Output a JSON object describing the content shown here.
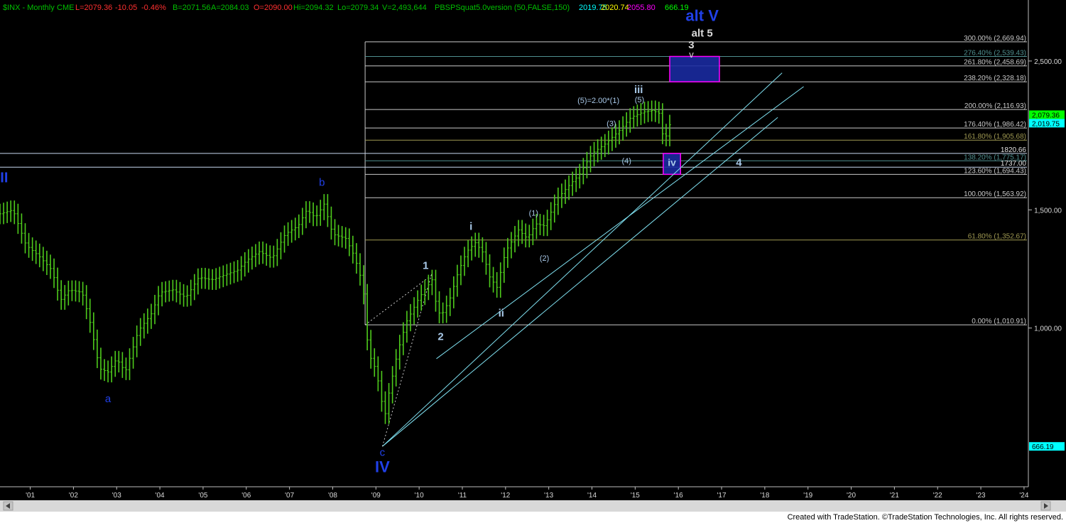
{
  "header": {
    "symbol": "$INX - Monthly",
    "exchange": "CME",
    "last": "L=2079.36",
    "change": "-10.05",
    "change_pct": "-0.46%",
    "bid": "B=2071.56",
    "ask": "A=2084.03",
    "open": "O=2090.00",
    "high": "Hi=2094.32",
    "low": "Lo=2079.34",
    "volume": "V=2,493,644",
    "study": "PBSPSquat5.0version (50,FALSE,150)",
    "study_values": [
      {
        "text": "2019.75",
        "color": "#00ffff"
      },
      {
        "text": "2020.74",
        "color": "#ffff00"
      },
      {
        "text": "2055.80",
        "color": "#ff00ff"
      },
      {
        "text": "666.19",
        "color": "#00ff00"
      }
    ]
  },
  "footer": {
    "credit": "Created with TradeStation. ©TradeStation Technologies, Inc. All rights reserved."
  },
  "chart_data": {
    "type": "line",
    "scale": "log",
    "ylim": [
      580,
      2950
    ],
    "xlim": [
      2000.3,
      2024.1
    ],
    "grid": false,
    "x_ticks": [
      "'01",
      "'02",
      "'03",
      "'04",
      "'05",
      "'06",
      "'07",
      "'08",
      "'09",
      "'10",
      "'11",
      "'12",
      "'13",
      "'14",
      "'15",
      "'16",
      "'17",
      "'18",
      "'19",
      "'20",
      "'21",
      "'22",
      "'23",
      "'24"
    ],
    "y_ticks": [
      {
        "value": 2500,
        "label": "2,500.00"
      },
      {
        "value": 1500,
        "label": "1,500.00"
      },
      {
        "value": 1000,
        "label": "1,000.00"
      }
    ],
    "price_tags": [
      {
        "value": 2079.36,
        "label": "2,079.36",
        "bg": "#00ff00"
      },
      {
        "value": 2019.75,
        "label": "2,019.75",
        "bg": "#00ffff"
      },
      {
        "value": 666.19,
        "label": "666.19",
        "bg": "#00ffff"
      }
    ],
    "series": [
      {
        "color": "#4ecb1c",
        "points": [
          [
            2000.3,
            1480
          ],
          [
            2000.6,
            1500
          ],
          [
            2000.9,
            1330
          ],
          [
            2001.2,
            1280
          ],
          [
            2001.5,
            1220
          ],
          [
            2001.7,
            1100
          ],
          [
            2001.9,
            1140
          ],
          [
            2002.2,
            1130
          ],
          [
            2002.4,
            1010
          ],
          [
            2002.6,
            870
          ],
          [
            2002.8,
            860
          ],
          [
            2003.0,
            900
          ],
          [
            2003.2,
            860
          ],
          [
            2003.5,
            990
          ],
          [
            2003.8,
            1050
          ],
          [
            2004.0,
            1130
          ],
          [
            2004.3,
            1140
          ],
          [
            2004.6,
            1110
          ],
          [
            2004.9,
            1190
          ],
          [
            2005.2,
            1180
          ],
          [
            2005.5,
            1200
          ],
          [
            2005.8,
            1220
          ],
          [
            2006.0,
            1260
          ],
          [
            2006.3,
            1300
          ],
          [
            2006.6,
            1270
          ],
          [
            2006.9,
            1380
          ],
          [
            2007.2,
            1420
          ],
          [
            2007.4,
            1500
          ],
          [
            2007.6,
            1460
          ],
          [
            2007.8,
            1530
          ],
          [
            2008.0,
            1380
          ],
          [
            2008.3,
            1360
          ],
          [
            2008.5,
            1280
          ],
          [
            2008.7,
            1160
          ],
          [
            2008.8,
            960
          ],
          [
            2008.9,
            890
          ],
          [
            2009.0,
            870
          ],
          [
            2009.2,
            735
          ],
          [
            2009.3,
            800
          ],
          [
            2009.5,
            920
          ],
          [
            2009.7,
            1020
          ],
          [
            2010.0,
            1110
          ],
          [
            2010.3,
            1180
          ],
          [
            2010.4,
            1080
          ],
          [
            2010.5,
            1040
          ],
          [
            2010.7,
            1100
          ],
          [
            2010.9,
            1210
          ],
          [
            2011.1,
            1300
          ],
          [
            2011.3,
            1340
          ],
          [
            2011.5,
            1290
          ],
          [
            2011.6,
            1200
          ],
          [
            2011.8,
            1150
          ],
          [
            2012.0,
            1300
          ],
          [
            2012.3,
            1400
          ],
          [
            2012.5,
            1360
          ],
          [
            2012.7,
            1430
          ],
          [
            2012.9,
            1420
          ],
          [
            2013.2,
            1560
          ],
          [
            2013.5,
            1640
          ],
          [
            2013.7,
            1690
          ],
          [
            2014.0,
            1820
          ],
          [
            2014.3,
            1880
          ],
          [
            2014.6,
            1960
          ],
          [
            2014.9,
            2060
          ],
          [
            2015.2,
            2100
          ],
          [
            2015.4,
            2110
          ],
          [
            2015.55,
            2090
          ],
          [
            2015.65,
            1920
          ],
          [
            2015.75,
            1940
          ],
          [
            2015.85,
            2079.36
          ]
        ]
      }
    ],
    "fib_levels": [
      {
        "value": 2669.94,
        "label": "300.00% (2,669.94)",
        "color": "#c8c8c8"
      },
      {
        "value": 2539.43,
        "label": "276.40% (2,539.43)",
        "color": "#4f8f8f"
      },
      {
        "value": 2458.69,
        "label": "261.80% (2,458.69)",
        "color": "#c8c8c8"
      },
      {
        "value": 2328.18,
        "label": "238.20% (2,328.18)",
        "color": "#c8c8c8"
      },
      {
        "value": 2116.93,
        "label": "200.00% (2,116.93)",
        "color": "#c8c8c8"
      },
      {
        "value": 1986.42,
        "label": "176.40% (1,986.42)",
        "color": "#c8c8c8"
      },
      {
        "value": 1905.68,
        "label": "161.80% (1,905.68)",
        "color": "#a09a52"
      },
      {
        "value": 1775.17,
        "label": "138.20% (1,775.17)",
        "color": "#4f8f8f"
      },
      {
        "value": 1694.43,
        "label": "123.60% (1,694.43)",
        "color": "#c8c8c8"
      },
      {
        "value": 1563.92,
        "label": "100.00% (1,563.92)",
        "color": "#c8c8c8"
      },
      {
        "value": 1352.67,
        "label": "61.80% (1,352.67)",
        "color": "#a09a52"
      },
      {
        "value": 1010.91,
        "label": "0.00% (1,010.91)",
        "color": "#c8c8c8"
      }
    ],
    "full_width_levels": [
      {
        "value": 1820.66,
        "label": "1820.66"
      },
      {
        "value": 1737.0,
        "label": "1737.00"
      }
    ],
    "fib_start_x": 2008.75,
    "channel_lines": [
      {
        "x1": 2009.15,
        "y1": 666.19,
        "x2": 2018.4,
        "y2": 2400
      },
      {
        "x1": 2010.4,
        "y1": 900,
        "x2": 2018.9,
        "y2": 2290
      },
      {
        "x1": 2009.15,
        "y1": 666.19,
        "x2": 2018.3,
        "y2": 2060
      }
    ],
    "dotted_lines": [
      {
        "x1": 2008.75,
        "y1": 1010.91,
        "x2": 2010.3,
        "y2": 1200
      },
      {
        "x1": 2009.15,
        "y1": 666.19,
        "x2": 2010.3,
        "y2": 1210
      }
    ],
    "target_boxes": [
      {
        "x1": 2015.8,
        "x2": 2016.95,
        "y1": 2328.18,
        "y2": 2539.43,
        "stroke": "#ff00ff",
        "fill": "#1a2aa0"
      },
      {
        "x1": 2015.65,
        "x2": 2016.05,
        "y1": 1694.43,
        "y2": 1820.66,
        "stroke": "#ff00ff",
        "fill": "#1a2aa0"
      }
    ],
    "annotations": [
      {
        "text": "III",
        "x": 2000.35,
        "y": 1650,
        "color": "#2040e8",
        "size": 20,
        "bold": true
      },
      {
        "text": "a",
        "x": 2002.8,
        "y": 775,
        "color": "#2040e8",
        "size": 15,
        "bold": false
      },
      {
        "text": "b",
        "x": 2007.75,
        "y": 1630,
        "color": "#2040e8",
        "size": 15,
        "bold": false
      },
      {
        "text": "c",
        "x": 2009.15,
        "y": 645,
        "color": "#2040e8",
        "size": 15,
        "bold": false
      },
      {
        "text": "IV",
        "x": 2009.15,
        "y": 610,
        "color": "#2040e8",
        "size": 22,
        "bold": true
      },
      {
        "text": "1",
        "x": 2010.15,
        "y": 1225,
        "color": "#a8c8e8",
        "size": 15,
        "bold": true
      },
      {
        "text": "2",
        "x": 2010.5,
        "y": 960,
        "color": "#a8c8e8",
        "size": 15,
        "bold": true
      },
      {
        "text": "i",
        "x": 2011.2,
        "y": 1400,
        "color": "#a8c8e8",
        "size": 15,
        "bold": true
      },
      {
        "text": "ii",
        "x": 2011.9,
        "y": 1040,
        "color": "#a8c8e8",
        "size": 15,
        "bold": true
      },
      {
        "text": "(1)",
        "x": 2012.65,
        "y": 1470,
        "color": "#a8c8e8",
        "size": 11,
        "bold": false
      },
      {
        "text": "(2)",
        "x": 2012.9,
        "y": 1260,
        "color": "#a8c8e8",
        "size": 11,
        "bold": false
      },
      {
        "text": "(3)",
        "x": 2014.45,
        "y": 2000,
        "color": "#a8c8e8",
        "size": 11,
        "bold": false
      },
      {
        "text": "(4)",
        "x": 2014.8,
        "y": 1760,
        "color": "#a8c8e8",
        "size": 11,
        "bold": false
      },
      {
        "text": "(5)=2.00*(1)",
        "x": 2014.15,
        "y": 2165,
        "color": "#a8c8e8",
        "size": 11,
        "bold": false
      },
      {
        "text": "(5)",
        "x": 2015.1,
        "y": 2170,
        "color": "#a8c8e8",
        "size": 11,
        "bold": false
      },
      {
        "text": "iii",
        "x": 2015.08,
        "y": 2240,
        "color": "#a8c8e8",
        "size": 15,
        "bold": true
      },
      {
        "text": "iv",
        "x": 2015.85,
        "y": 1745,
        "color": "#a8c8e8",
        "size": 14,
        "bold": true
      },
      {
        "text": "4",
        "x": 2017.4,
        "y": 1745,
        "color": "#a8c8e8",
        "size": 15,
        "bold": true
      },
      {
        "text": "v",
        "x": 2016.3,
        "y": 2530,
        "color": "#d8d8d8",
        "size": 13,
        "bold": false
      },
      {
        "text": "3",
        "x": 2016.3,
        "y": 2610,
        "color": "#d8d8d8",
        "size": 15,
        "bold": true
      },
      {
        "text": "alt 5",
        "x": 2016.55,
        "y": 2720,
        "color": "#d8d8d8",
        "size": 15,
        "bold": true
      },
      {
        "text": "alt V",
        "x": 2016.55,
        "y": 2870,
        "color": "#2040e8",
        "size": 22,
        "bold": true
      }
    ]
  }
}
